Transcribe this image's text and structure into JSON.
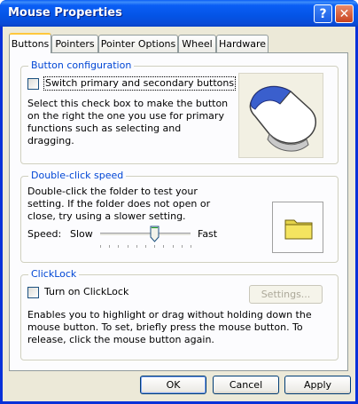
{
  "window": {
    "title": "Mouse Properties"
  },
  "titlebar": {
    "help_label": "?",
    "close_label": "✕"
  },
  "tabs": [
    {
      "label": "Buttons",
      "active": true
    },
    {
      "label": "Pointers",
      "active": false
    },
    {
      "label": "Pointer Options",
      "active": false
    },
    {
      "label": "Wheel",
      "active": false
    },
    {
      "label": "Hardware",
      "active": false
    }
  ],
  "button_config": {
    "legend": "Button configuration",
    "checkbox_label": "Switch primary and secondary buttons",
    "checked": false,
    "description": "Select this check box to make the button on the right the one you use for primary functions such as selecting and dragging."
  },
  "double_click": {
    "legend": "Double-click speed",
    "description": "Double-click the folder to test your setting. If the folder does not open or close, try using a slower setting.",
    "speed_label": "Speed:",
    "slow_label": "Slow",
    "fast_label": "Fast",
    "speed_level": 0.6,
    "folder_icon": "folder-icon"
  },
  "clicklock": {
    "legend": "ClickLock",
    "checkbox_label_prefix": "",
    "checkbox_label": "Turn on ClickLock",
    "checked": false,
    "settings_label": "Settings...",
    "description": "Enables you to highlight or drag without holding down the mouse button. To set, briefly press the mouse button. To release, click the mouse button again."
  },
  "footer": {
    "ok_label": "OK",
    "cancel_label": "Cancel",
    "apply_label": "Apply"
  },
  "colors": {
    "title_blue": "#0a5ef5",
    "legend_blue": "#0046d5",
    "tab_highlight": "#ffc83c"
  }
}
